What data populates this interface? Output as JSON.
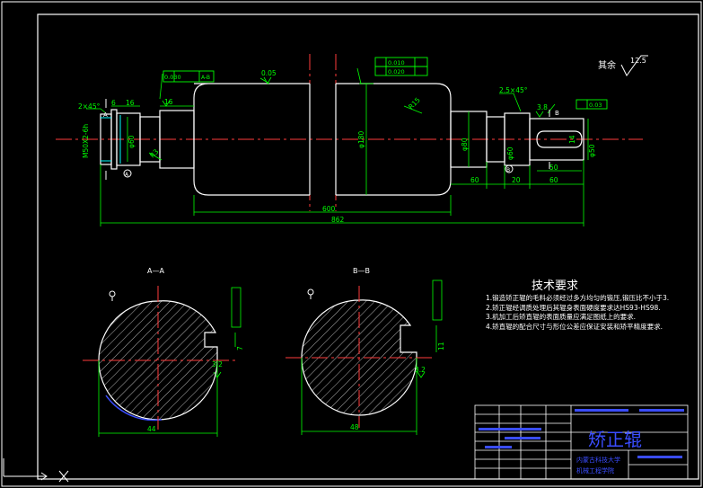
{
  "drawing": {
    "roughness_note": {
      "text": "其余",
      "value": "12.5"
    },
    "requirements_title": "技术要求",
    "requirements": [
      "1.锻造矫正辊的毛料必须经过多方均匀的锻压,锻压比不小于3.",
      "2.矫正辊经调质处理后其辊身表面硬度要求达HS93-HS98.",
      "3.机加工后矫直辊的表面质量应满足图纸上的要求.",
      "4.矫直辊的配合尺寸与形位公差应保证安装和矫平精度要求."
    ],
    "title_block": {
      "part_name": "矫正辊",
      "school_line1": "内蒙古科技大学",
      "school_line2": "机械工程学院"
    },
    "dimensions": {
      "chamfer_left": "2×45°",
      "chamfer_right": "2.5×45°",
      "len_6": "6",
      "len_16a": "16",
      "len_16b": "16",
      "thread_left": "M50X2-6h",
      "dia_left": "φ60",
      "radius_r3": "R3",
      "roughness_005": "0.05",
      "roughness_16": "1.6",
      "roughness_32": "3.2",
      "roughness_38": "3.8",
      "dia_body": "φ180",
      "radius_r15": "R15",
      "dia_right_a": "φ80",
      "dia_right_b": "φ60",
      "dia_right_end": "φ50",
      "len_600": "600",
      "len_862": "862",
      "len_60a": "60",
      "len_20": "20",
      "len_50": "50",
      "len_60b": "60",
      "dia_right_small": "φ56",
      "key_len": "14",
      "section_aa": "A—A",
      "section_bb": "B—B",
      "aa_depth": "44",
      "aa_key": "7",
      "aa_rough": "3.2",
      "bb_depth": "48",
      "bb_key": "11",
      "bb_rough": "3.2",
      "tol_a": "0.030",
      "tol_b": "0.010",
      "tol_c": "0.020",
      "tol_d": "0.03",
      "datum_a": "A-B",
      "label_a_left": "A",
      "label_b_right": "B",
      "datum_circle_a": "A",
      "datum_circle_b": "B"
    }
  }
}
